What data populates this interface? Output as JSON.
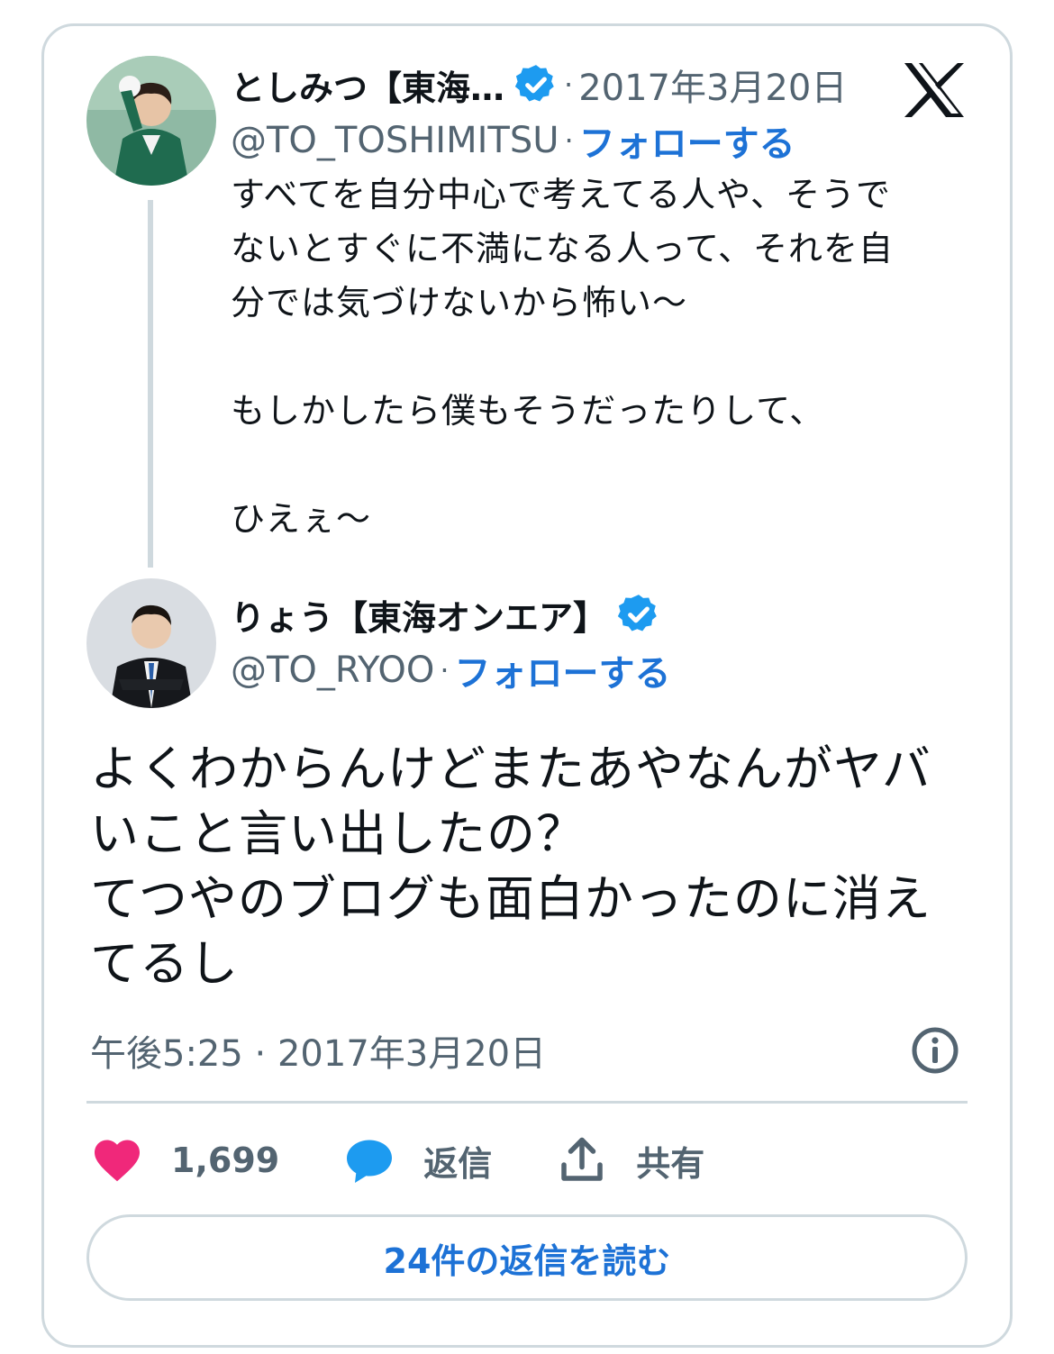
{
  "colors": {
    "accent": "#1d72d6",
    "secondary_text": "#536471",
    "border": "#cfd9de",
    "like": "#f0287a",
    "reply_bubble": "#1d9bf0"
  },
  "parent_tweet": {
    "display_name": "としみつ【東海…",
    "verified_icon": "verified-badge-icon",
    "separator": "·",
    "date": "2017年3月20日",
    "handle": "@TO_TOSHIMITSU",
    "handle_separator": "·",
    "follow_label": "フォローする",
    "paragraphs": [
      "すべてを自分中心で考えてる人や、そうで\nないとすぐに不満になる人って、それを自\n分では気づけないから怖い〜",
      "もしかしたら僕もそうだったりして、",
      "ひえぇ〜"
    ]
  },
  "main_tweet": {
    "display_name": "りょう【東海オンエア】",
    "handle": "@TO_RYOO",
    "handle_separator": "·",
    "follow_label": "フォローする",
    "text": "よくわからんけどまたあやなんがヤバ\nいこと言い出したの？\nてつやのブログも面白かったのに消え\nてるし",
    "timestamp": "午後5:25 · 2017年3月20日"
  },
  "actions": {
    "like_count": "1,699",
    "reply_label": "返信",
    "share_label": "共有"
  },
  "read_replies_label": "24件の返信を読む",
  "icons": [
    "x-logo-icon",
    "verified-badge-icon",
    "info-icon",
    "heart-icon",
    "reply-bubble-icon",
    "share-icon"
  ]
}
